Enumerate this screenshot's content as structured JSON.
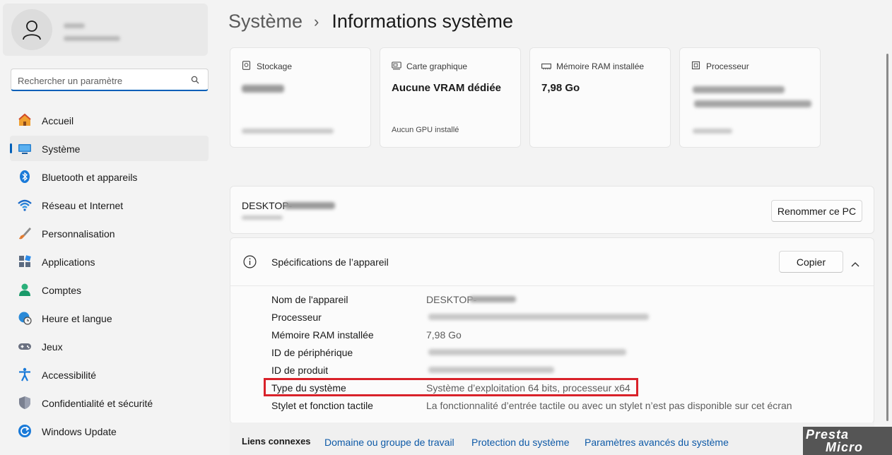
{
  "sidebar": {
    "search_placeholder": "Rechercher un paramètre",
    "items": [
      {
        "label": "Accueil",
        "icon": "home-icon"
      },
      {
        "label": "Système",
        "icon": "system-icon",
        "active": true
      },
      {
        "label": "Bluetooth et appareils",
        "icon": "bluetooth-icon"
      },
      {
        "label": "Réseau et Internet",
        "icon": "wifi-icon"
      },
      {
        "label": "Personnalisation",
        "icon": "brush-icon"
      },
      {
        "label": "Applications",
        "icon": "apps-icon"
      },
      {
        "label": "Comptes",
        "icon": "account-icon"
      },
      {
        "label": "Heure et langue",
        "icon": "globe-clock-icon"
      },
      {
        "label": "Jeux",
        "icon": "gamepad-icon"
      },
      {
        "label": "Accessibilité",
        "icon": "accessibility-icon"
      },
      {
        "label": "Confidentialité et sécurité",
        "icon": "shield-icon"
      },
      {
        "label": "Windows Update",
        "icon": "update-icon"
      }
    ]
  },
  "breadcrumb": {
    "parent": "Système",
    "separator": "›",
    "current": "Informations système"
  },
  "cards": [
    {
      "title": "Stockage",
      "icon": "storage-icon",
      "value": "",
      "sub": ""
    },
    {
      "title": "Carte graphique",
      "icon": "gpu-icon",
      "value": "Aucune VRAM dédiée",
      "sub": "Aucun GPU installé"
    },
    {
      "title": "Mémoire RAM installée",
      "icon": "ram-icon",
      "value": "7,98 Go",
      "sub": ""
    },
    {
      "title": "Processeur",
      "icon": "cpu-icon",
      "value": "",
      "sub": ""
    }
  ],
  "device": {
    "name": "DESKTOP-",
    "rename_label": "Renommer ce PC"
  },
  "specs": {
    "title": "Spécifications de l’appareil",
    "copy_label": "Copier",
    "rows": [
      {
        "label": "Nom de l'appareil",
        "value": "DESKTOP-"
      },
      {
        "label": "Processeur",
        "value": ""
      },
      {
        "label": "Mémoire RAM installée",
        "value": "7,98 Go"
      },
      {
        "label": "ID de périphérique",
        "value": ""
      },
      {
        "label": "ID de produit",
        "value": ""
      },
      {
        "label": "Type du système",
        "value": "Système d’exploitation 64 bits, processeur x64"
      },
      {
        "label": "Stylet et fonction tactile",
        "value": "La fonctionnalité d’entrée tactile ou avec un stylet n’est pas disponible sur cet écran"
      }
    ]
  },
  "related": {
    "title": "Liens connexes",
    "links": [
      "Domaine ou groupe de travail",
      "Protection du système",
      "Paramètres avancés du système"
    ]
  },
  "watermark": {
    "line1": "Presta",
    "line2": "Micro"
  },
  "colors": {
    "accent": "#005fb8",
    "highlight": "#d9222a",
    "link": "#0e5aa7"
  }
}
